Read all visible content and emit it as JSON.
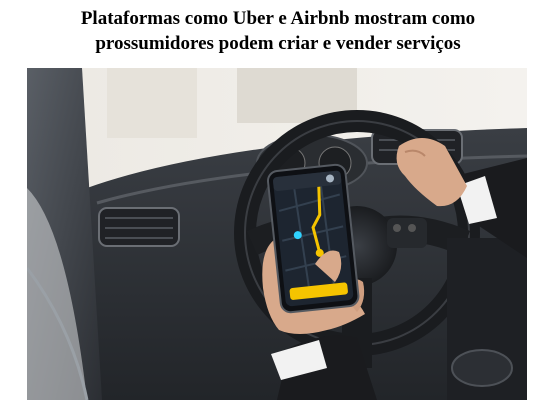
{
  "caption": {
    "line1": "Plataformas como Uber e Airbnb mostram como",
    "line2": "prossumidores podem criar e vender serviços"
  },
  "photo": {
    "subject": "driver-holding-smartphone-navigation-app",
    "colors": {
      "window_light": "#f2f0ec",
      "dashboard": "#2f3338",
      "steering_wheel": "#1b1d20",
      "suit": "#1a1b1e",
      "skin": "#d8a98b",
      "phone_screen": "#1d2530",
      "app_accent": "#f5c400"
    }
  }
}
